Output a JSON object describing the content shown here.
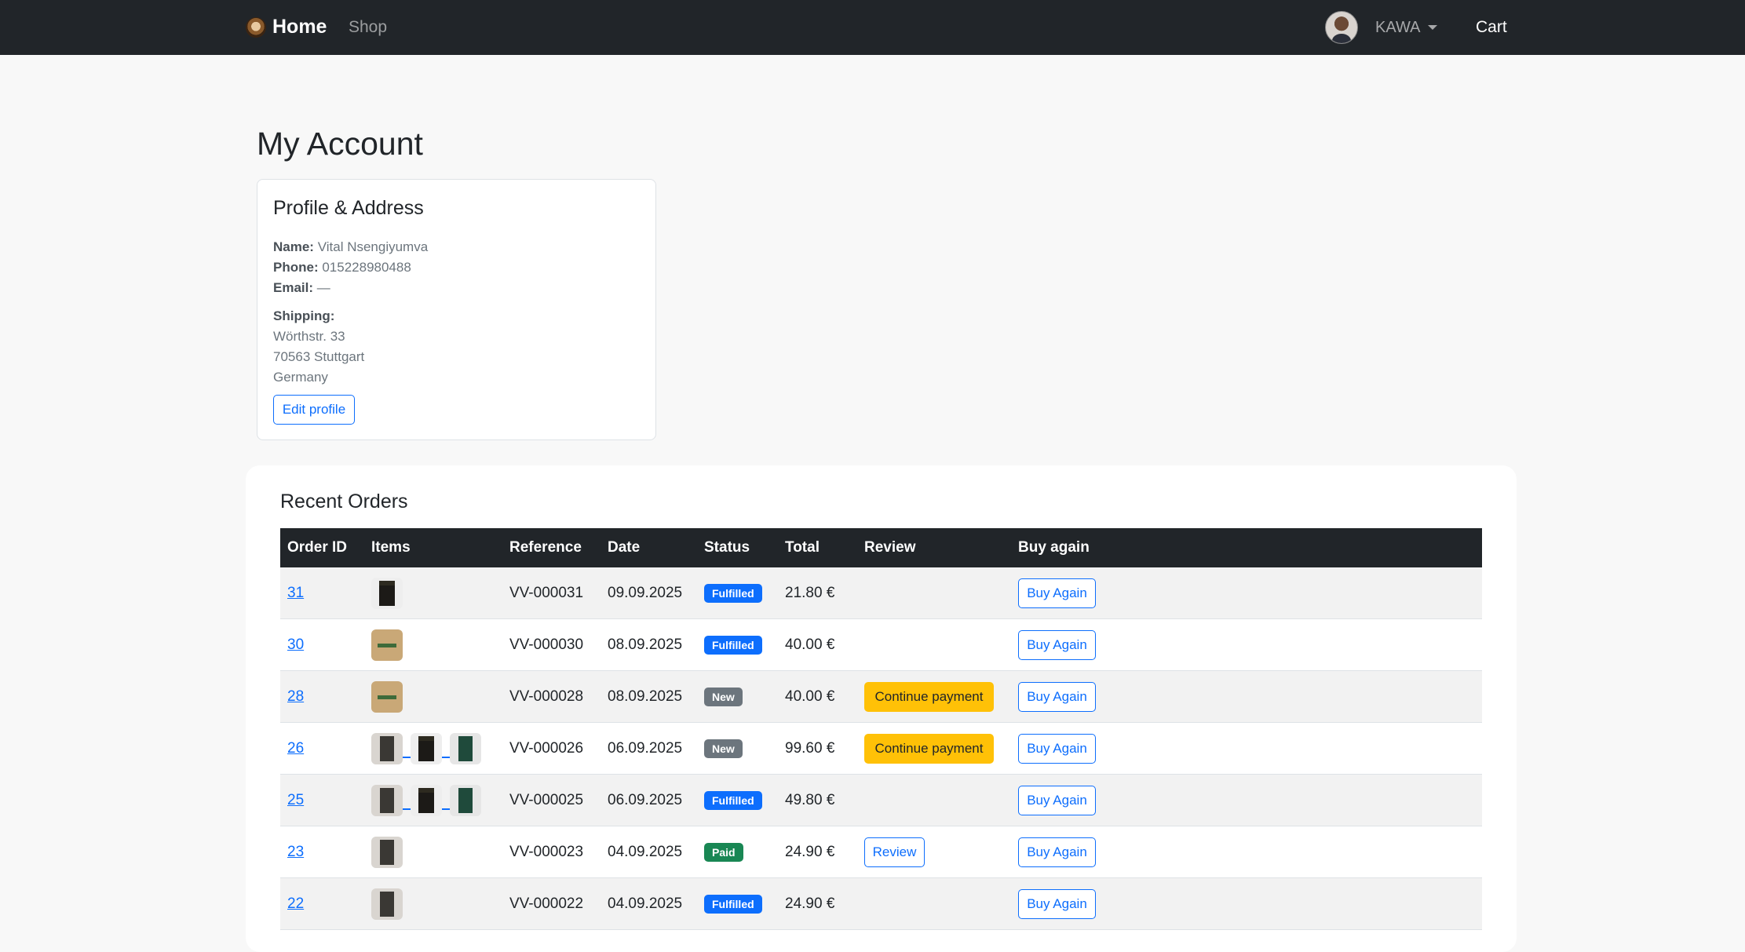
{
  "nav": {
    "brand": "Home",
    "shop": "Shop",
    "user": "KAWA",
    "cart": "Cart"
  },
  "page_title": "My Account",
  "profile": {
    "heading": "Profile & Address",
    "name_label": "Name:",
    "name": "Vital Nsengiyumva",
    "phone_label": "Phone:",
    "phone": "015228980488",
    "email_label": "Email:",
    "email": "—",
    "shipping_label": "Shipping:",
    "street": "Wörthstr. 33",
    "city": "70563 Stuttgart",
    "country": "Germany",
    "edit_button": "Edit profile"
  },
  "orders": {
    "title": "Recent Orders",
    "columns": [
      "Order ID",
      "Items",
      "Reference",
      "Date",
      "Status",
      "Total",
      "Review",
      "Buy again"
    ],
    "rows": [
      {
        "id": "31",
        "items": [
          "dark"
        ],
        "reference": "VV-000031",
        "date": "09.09.2025",
        "status": "Fulfilled",
        "total": "21.80 €",
        "review": "",
        "buy": "Buy Again"
      },
      {
        "id": "30",
        "items": [
          "kraft"
        ],
        "reference": "VV-000030",
        "date": "08.09.2025",
        "status": "Fulfilled",
        "total": "40.00 €",
        "review": "",
        "buy": "Buy Again"
      },
      {
        "id": "28",
        "items": [
          "kraft"
        ],
        "reference": "VV-000028",
        "date": "08.09.2025",
        "status": "New",
        "total": "40.00 €",
        "review": "Continue payment",
        "buy": "Buy Again"
      },
      {
        "id": "26",
        "items": [
          "grey",
          "dark",
          "green"
        ],
        "reference": "VV-000026",
        "date": "06.09.2025",
        "status": "New",
        "total": "99.60 €",
        "review": "Continue payment",
        "buy": "Buy Again"
      },
      {
        "id": "25",
        "items": [
          "grey",
          "dark",
          "green"
        ],
        "reference": "VV-000025",
        "date": "06.09.2025",
        "status": "Fulfilled",
        "total": "49.80 €",
        "review": "",
        "buy": "Buy Again"
      },
      {
        "id": "23",
        "items": [
          "grey"
        ],
        "reference": "VV-000023",
        "date": "04.09.2025",
        "status": "Paid",
        "total": "24.90 €",
        "review": "Review",
        "buy": "Buy Again"
      },
      {
        "id": "22",
        "items": [
          "grey"
        ],
        "reference": "VV-000022",
        "date": "04.09.2025",
        "status": "Fulfilled",
        "total": "24.90 €",
        "review": "",
        "buy": "Buy Again"
      }
    ]
  },
  "colors": {
    "navbar": "#212529",
    "primary": "#0d6efd",
    "warning": "#ffc107",
    "success": "#198754",
    "secondary": "#6c757d"
  }
}
